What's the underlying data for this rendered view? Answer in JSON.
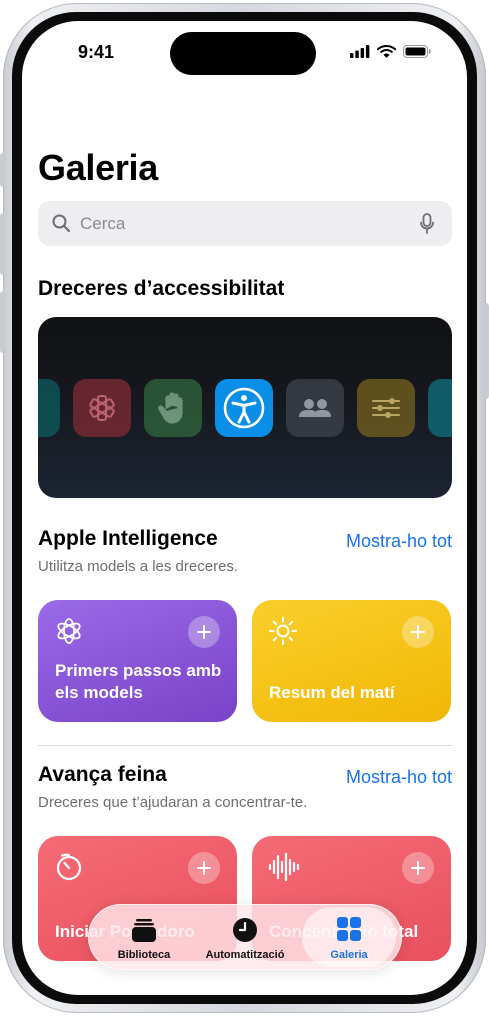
{
  "status_bar": {
    "time": "9:41"
  },
  "page": {
    "title": "Galeria"
  },
  "search": {
    "placeholder": "Cerca"
  },
  "accessibility": {
    "title": "Dreceres d’accessibilitat"
  },
  "apple_intelligence": {
    "title": "Apple Intelligence",
    "subtitle": "Utilitza models a les dreceres.",
    "see_all": "Mostra-ho tot",
    "cards": [
      {
        "label": "Primers passos amb els models",
        "icon": "models-icon",
        "color": "#8a4fd9"
      },
      {
        "label": "Resum del matí",
        "icon": "sun-icon",
        "color": "#f2b705"
      }
    ]
  },
  "get_work_done": {
    "title": "Avança feina",
    "subtitle": "Dreceres que t’ajudaran a concentrar-te.",
    "see_all": "Mostra-ho tot",
    "cards": [
      {
        "label": "Iniciar Pomodoro",
        "icon": "timer-icon",
        "color": "#ef5a67"
      },
      {
        "label": "Concentració total",
        "icon": "waveform-icon",
        "color": "#ef5a67"
      }
    ]
  },
  "tab_bar": {
    "items": [
      {
        "label": "Biblioteca",
        "icon": "library-icon",
        "active": false
      },
      {
        "label": "Automatització",
        "icon": "clock-icon",
        "active": false
      },
      {
        "label": "Galeria",
        "icon": "gallery-icon",
        "active": true
      }
    ]
  },
  "colors": {
    "accent": "#1a73e8",
    "hero_active_tile": "#0a8fe8"
  }
}
